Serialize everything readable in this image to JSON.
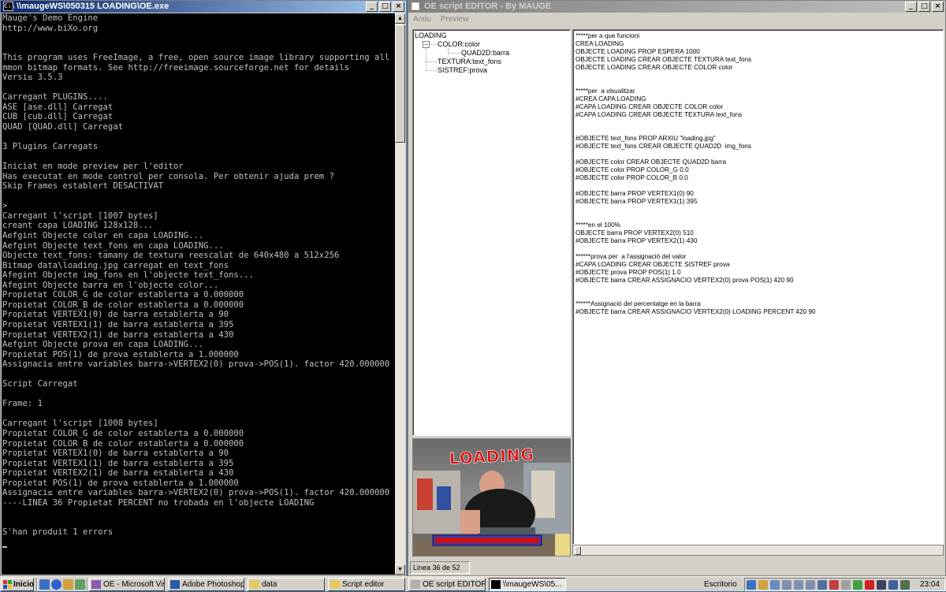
{
  "console": {
    "title": "\\\\maugeWS\\050315 LOADING\\OE.exe",
    "icon_text": "C:\\",
    "lines": [
      "Mauge's Demo Engine",
      "http://www.biXo.org",
      "",
      "",
      "This program uses FreeImage, a free, open source image library supporting all co",
      "mmon bitmap formats. See http://freeimage.sourceforge.net for details",
      "Versi≤ 3.5.3",
      "",
      "Carregant PLUGINS....",
      "ASE [ase.dll] Carregat",
      "CUB [cub.dll] Carregat",
      "QUAD [QUAD.dll] Carregat",
      "",
      "3 Plugins Carregats",
      "",
      "Iniciat en mode preview per l'editor",
      "Has executat en mode control per consola. Per obtenir ajuda prem ?",
      "Skip Frames establert DESACTIVAT",
      "",
      ">",
      "Carregant l'script [1007 bytes]",
      "creant capa LOADING 128x128...",
      "Aefgint Objecte color en capa LOADING...",
      "Aefgint Objecte text_fons en capa LOADING...",
      "Objecte text_fons: tamany de textura reescalat de 640x480 a 512x256",
      "Bitmap data\\loading.jpg carregat en text_fons",
      "Afegint Objecte img_fons en l'objecte text_fons...",
      "Afegint Objecte barra en l'objecte color...",
      "Propietat COLOR_G de color establerta a 0.000000",
      "Propietat COLOR_B de color establerta a 0.000000",
      "Propietat VERTEX1(0) de barra establerta a 90",
      "Propietat VERTEX1(1) de barra establerta a 395",
      "Propietat VERTEX2(1) de barra establerta a 430",
      "Aefgint Objecte prova en capa LOADING...",
      "Propietat POS(1) de prova establerta a 1.000000",
      "Assignaci≤ entre variables barra->VERTEX2(0) prova->POS(1). factor 420.000000",
      "",
      "Script Carregat",
      "",
      "Frame: 1",
      "",
      "Carregant l'script [1008 bytes]",
      "Propietat COLOR_G de color establerta a 0.000000",
      "Propietat COLOR_B de color establerta a 0.000000",
      "Propietat VERTEX1(0) de barra establerta a 90",
      "Propietat VERTEX1(1) de barra establerta a 395",
      "Propietat VERTEX2(1) de barra establerta a 430",
      "Propietat POS(1) de prova establerta a 1.000000",
      "Assignaci≤ entre variables barra->VERTEX2(0) prova->POS(1). factor 420.000000",
      "----LINEA 36 Propietat PERCENT no trobada en l'objecte LOADING",
      "",
      "",
      "S'han produit 1 errors"
    ]
  },
  "editor": {
    "title": "OE script EDITOR - By MAUGE",
    "menu": [
      "Arxiu",
      "Preview"
    ],
    "tree": {
      "root": "LOADING",
      "color": "COLOR:color",
      "quad": "QUAD2D:barra",
      "textura": "TEXTURA:text_fons",
      "sistref": "SISTREF:prova",
      "expander": "−"
    },
    "preview": {
      "loading_text": "LOADING",
      "bar_color": "#cc1111"
    },
    "code_lines": [
      "*****per a que funcioni",
      "CREA LOADING",
      "OBJECTE LOADING PROP ESPERA 1000",
      "OBJECTE LOADING CREAR OBJECTE TEXTURA text_fons",
      "OBJECTE LOADING CREAR OBJECTE COLOR color",
      "",
      "",
      "*****per  a visualitzar",
      "#CREA CAPA LOADING",
      "#CAPA LOADING CREAR OBJECTE COLOR color",
      "#CAPA LOADING CREAR OBJECTE TEXTURA text_fons",
      "",
      "",
      "#OBJECTE text_fons PROP ARXIU \"loading.jpg\"",
      "#OBJECTE text_fons CREAR OBJECTE QUAD2D  img_fons",
      "",
      "#OBJECTE color CREAR OBJECTE QUAD2D barra",
      "#OBJECTE color PROP COLOR_G 0.0",
      "#OBJECTE color PROP COLOR_B 0.0",
      "",
      "#OBJECTE barra PROP VERTEX1(0) 90",
      "#OBJECTE barra PROP VERTEX1(1) 395",
      "",
      "",
      "*****en el 100%",
      "OBJECTE barra PROP VERTEX2(0) 510",
      "#OBJECTE barra PROP VERTEX2(1) 430",
      "",
      "******prova per  a l'assignació del valor",
      "#CAPA LOADING CREAR OBJECTE SISTREF prova",
      "#OBJECTE prova PROP POS(1) 1.0",
      "#OBJECTE barra CREAR ASSIGNACIO VERTEX2(0) prova POS(1) 420 90",
      "",
      "",
      "******Assignació del percentatge en la barra",
      "#OBJECTE barra CREAR ASSIGNACIO VERTEX2(0) LOADING PERCENT 420 90"
    ],
    "status": "Linea 36 de 52"
  },
  "taskbar": {
    "start": "Inicio",
    "tasks": [
      {
        "label": "OE - Microsoft Visu...",
        "icon": "visual-studio-icon",
        "color": "#8a5ab0"
      },
      {
        "label": "Adobe Photoshop",
        "icon": "photoshop-icon",
        "color": "#2a5aa8"
      },
      {
        "label": "data",
        "icon": "folder-icon",
        "color": "#e8c860"
      },
      {
        "label": "Script editor",
        "icon": "folder-icon",
        "color": "#e8c860"
      },
      {
        "label": "OE script EDITOR ...",
        "icon": "app-icon",
        "color": "#b0b0b0"
      },
      {
        "label": "\\\\maugeWS\\05...",
        "icon": "console-icon",
        "color": "#000000"
      }
    ],
    "desktop_label": "Escritorio",
    "clock": "23:04"
  },
  "colors": {
    "title_active": "#0a246a",
    "console_bg": "#000000",
    "console_fg": "#c0c0c0",
    "window_face": "#d4d0c8"
  }
}
